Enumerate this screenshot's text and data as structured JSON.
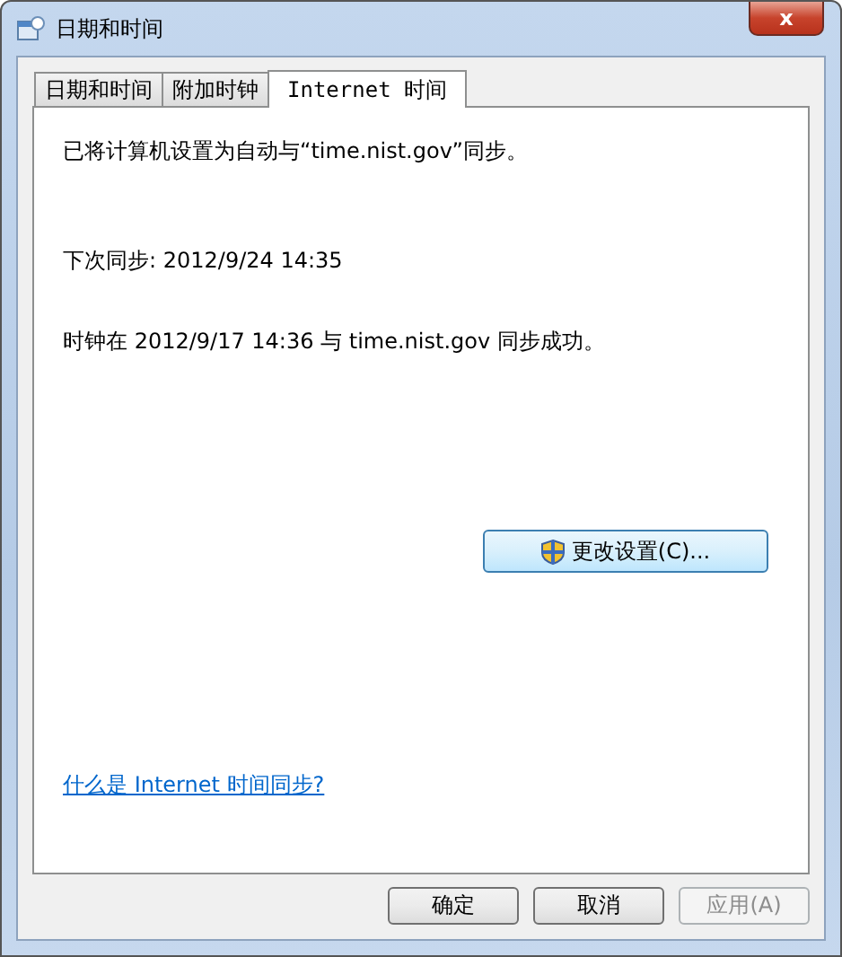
{
  "window": {
    "title": "日期和时间",
    "close": "x"
  },
  "tabs": [
    {
      "label": "日期和时间",
      "selected": false
    },
    {
      "label": "附加时钟",
      "selected": false
    },
    {
      "label": "Internet 时间",
      "selected": true
    }
  ],
  "panel": {
    "lines": [
      "已将计算机设置为自动与“time.nist.gov”同步。",
      "下次同步: 2012/9/24 14:35",
      "时钟在 2012/9/17 14:36 与 time.nist.gov 同步成功。"
    ],
    "change_button": "更改设置(C)...",
    "help_link": "什么是 Internet 时间同步?"
  },
  "buttons": [
    {
      "label": "确定",
      "disabled": false
    },
    {
      "label": "取消",
      "disabled": false
    },
    {
      "label": "应用(A)",
      "disabled": true
    }
  ]
}
